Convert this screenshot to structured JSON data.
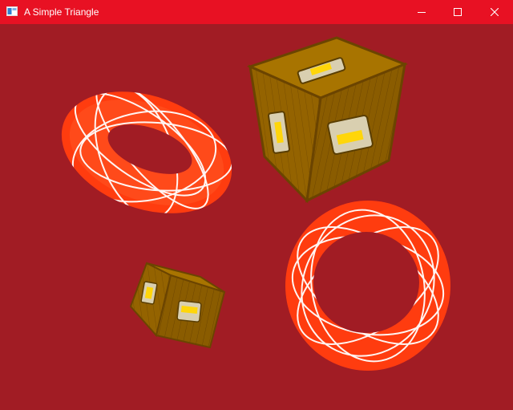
{
  "window": {
    "title": "A Simple Triangle",
    "titlebar_color": "#e81123",
    "controls": [
      {
        "name": "minimize-button",
        "icon": "minimize-icon"
      },
      {
        "name": "maximize-button",
        "icon": "maximize-icon"
      },
      {
        "name": "close-button",
        "icon": "close-icon"
      }
    ]
  },
  "scene": {
    "clear_color": "#a11c24",
    "objects": [
      {
        "name": "torus-top-left",
        "kind": "torus",
        "color": "#ff3c0f",
        "stripe_color": "#ffffff"
      },
      {
        "name": "crate-top-right",
        "kind": "wooden-crate",
        "color": "#9b6a00"
      },
      {
        "name": "crate-small-bottom",
        "kind": "wooden-crate",
        "color": "#9b6a00"
      },
      {
        "name": "torus-bottom-right",
        "kind": "torus",
        "color": "#ff3c0f",
        "stripe_color": "#ffffff"
      }
    ]
  }
}
